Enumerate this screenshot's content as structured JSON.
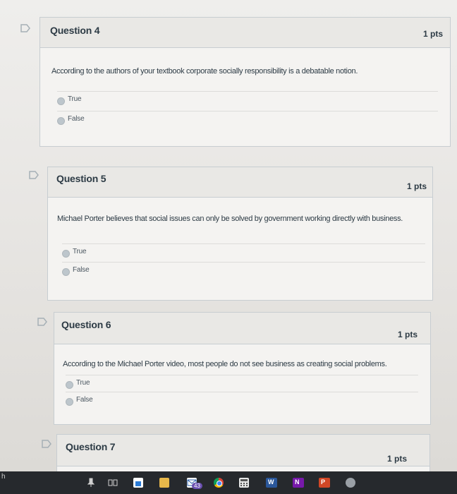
{
  "questions": [
    {
      "title": "Question 4",
      "points": "1 pts",
      "text": "According to the authors of your textbook corporate socially responsibility is a debatable notion.",
      "options": [
        "True",
        "False"
      ]
    },
    {
      "title": "Question 5",
      "points": "1 pts",
      "text": "Michael Porter believes that social issues can only be solved by government working directly with business.",
      "options": [
        "True",
        "False"
      ]
    },
    {
      "title": "Question 6",
      "points": "1 pts",
      "text": "According to the Michael Porter video, most people do not see business as creating social problems.",
      "options": [
        "True",
        "False"
      ]
    },
    {
      "title": "Question 7",
      "points": "1 pts"
    }
  ],
  "taskbar": {
    "edge_text": "h",
    "badge_count": "43",
    "apps": [
      "pin-icon",
      "task-view-icon",
      "store-icon",
      "file-explorer-icon",
      "mail-icon",
      "chrome-icon",
      "calculator-icon",
      "word-icon",
      "onenote-icon",
      "powerpoint-icon",
      "other-app-icon"
    ]
  },
  "colors": {
    "card_border": "#c7cdd1",
    "header_bg": "#e9e8e5",
    "text": "#2d3b45",
    "radio": "#bdc6cc",
    "taskbar": "#26292d"
  }
}
